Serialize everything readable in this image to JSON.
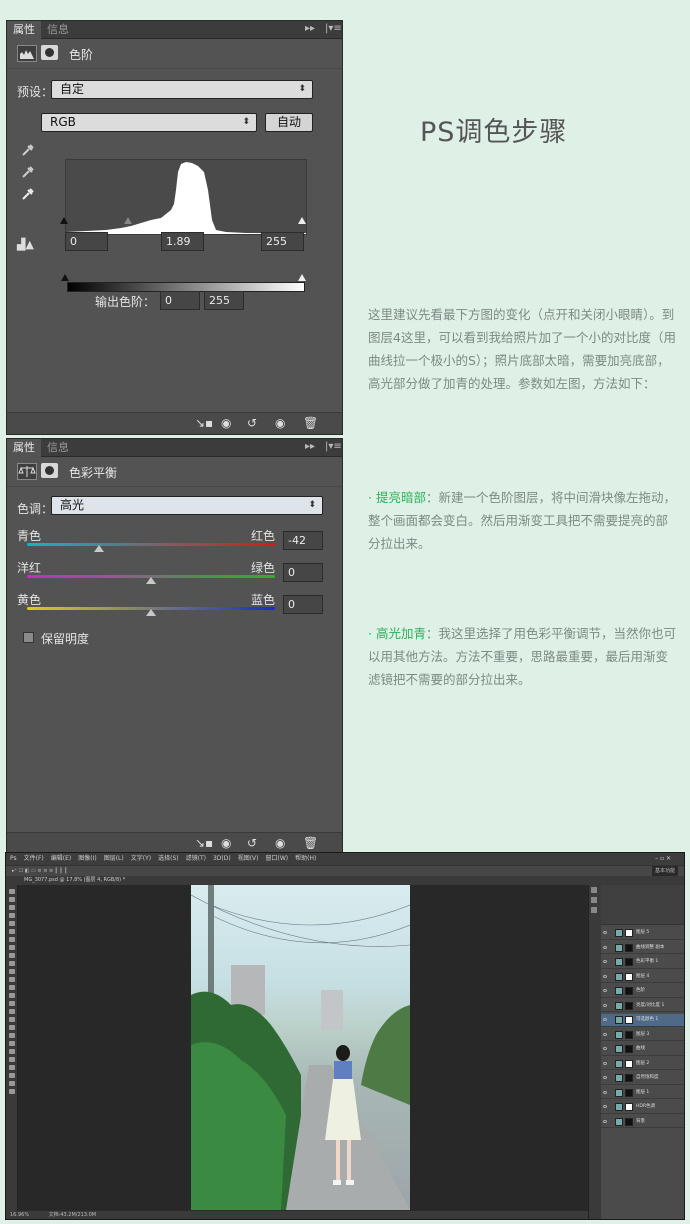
{
  "levels_panel": {
    "tabs": [
      "属性",
      "信息"
    ],
    "title": "色阶",
    "preset_label": "预设：",
    "preset_value": "自定",
    "channel_value": "RGB",
    "auto_button": "自动",
    "input_black": "0",
    "input_gamma": "1.89",
    "input_white": "255",
    "output_label": "输出色阶：",
    "output_black": "0",
    "output_white": "255"
  },
  "color_balance_panel": {
    "tabs": [
      "属性",
      "信息"
    ],
    "title": "色彩平衡",
    "tone_label": "色调：",
    "tone_value": "高光",
    "sliders": [
      {
        "left": "青色",
        "right": "红色",
        "value": "-42",
        "position": 0.29
      },
      {
        "left": "洋红",
        "right": "绿色",
        "value": "0",
        "position": 0.5
      },
      {
        "left": "黄色",
        "right": "蓝色",
        "value": "0",
        "position": 0.5
      }
    ],
    "preserve_luminosity": "保留明度"
  },
  "article": {
    "heading": "PS调色步骤",
    "intro": "这里建议先看最下方图的变化（点开和关闭小眼睛）。到图层4这里，可以看到我给照片加了一个小的对比度（用曲线拉一个极小的S）；照片底部太暗，需要加亮底部，高光部分做了加青的处理。参数如左图，方法如下：",
    "step1_highlight": "· 提亮暗部",
    "step1_text": "：新建一个色阶图层，将中间滑块像左拖动，整个画面都会变白。然后用渐变工具把不需要提亮的部分拉出来。",
    "step2_highlight": "· 高光加青",
    "step2_text": "：我这里选择了用色彩平衡调节，当然你也可以用其他方法。方法不重要，思路最重要，最后用渐变滤镜把不需要的部分拉出来。"
  },
  "photoshop": {
    "menu": [
      "Ps",
      "文件(F)",
      "编辑(E)",
      "图像(I)",
      "图层(L)",
      "文字(Y)",
      "选择(S)",
      "滤镜(T)",
      "3D(D)",
      "视图(V)",
      "窗口(W)",
      "帮助(H)"
    ],
    "workspace": "基本功能",
    "doc_tab": "MG_3077.psd @ 17.8% (图层 4, RGB/8) *",
    "zoom": "16.96%",
    "doc_size": "文档:43.2M/213.0M",
    "layers": [
      "图层 5",
      "曲线调整 副本",
      "色彩平衡 1",
      "图层 4",
      "色阶",
      "亮度/对比度 1",
      "可选颜色 1",
      "图层 3",
      "曲线",
      "图层 2",
      "自然饱和度",
      "图层 1",
      "HDR色调",
      "背景"
    ]
  },
  "colors": {
    "page_bg": "#dff1e6",
    "panel_bg": "#535353",
    "highlight_green": "#2eb05c",
    "body_text": "#7d8a84"
  }
}
